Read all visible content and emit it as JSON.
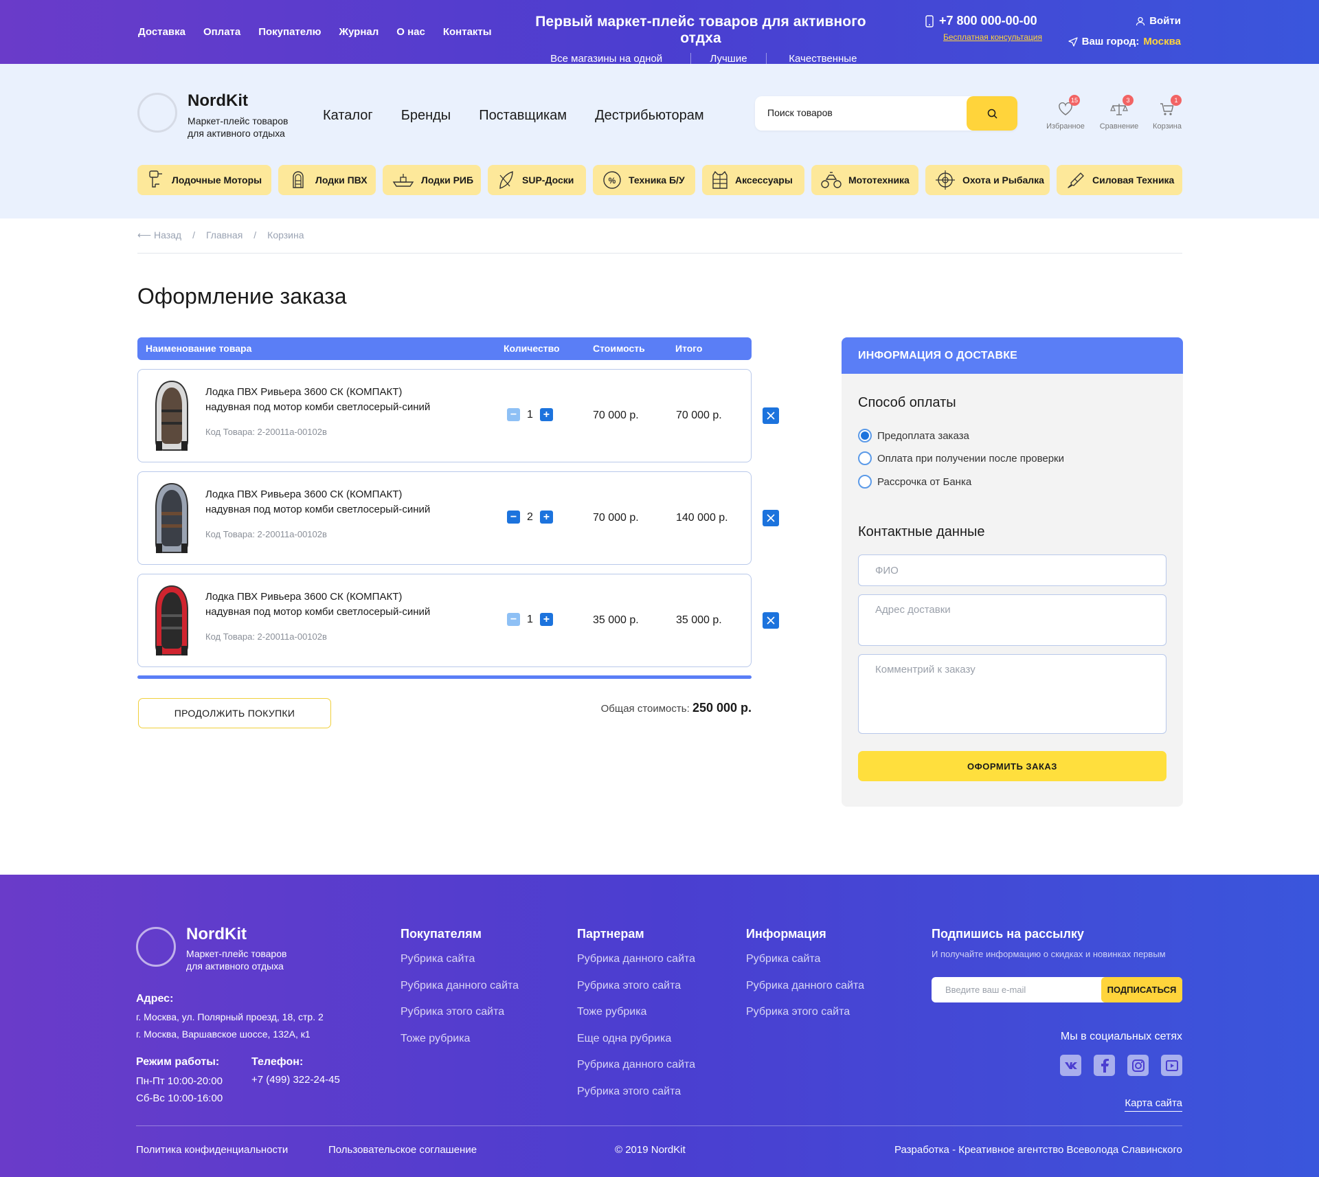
{
  "topbar": {
    "nav": [
      "Доставка",
      "Оплата",
      "Покупателю",
      "Журнал",
      "О нас",
      "Контакты"
    ],
    "slogan_title": "Первый маркет-плейс товаров для активного отдха",
    "slogan_items": [
      "Все магазины на одной платформе",
      "Лучшие цены",
      "Качественные бренды"
    ],
    "phone": "+7 800 000-00-00",
    "consult": "Бесплатная консультация",
    "login": "Войти",
    "city_label": "Ваш город:",
    "city": "Москва",
    "accent": "#ffd43b"
  },
  "header": {
    "brand": "NordKit",
    "brand_sub_1": "Маркет-плейс товаров",
    "brand_sub_2": "для активного отдыха",
    "nav": [
      "Каталог",
      "Бренды",
      "Поставщикам",
      "Дестрибьюторам"
    ],
    "search_placeholder": "Поиск товаров",
    "icons": [
      {
        "label": "Избранное",
        "badge": "15",
        "icon": "heart-icon"
      },
      {
        "label": "Сравнение",
        "badge": "3",
        "icon": "scales-icon"
      },
      {
        "label": "Корзина",
        "badge": "1",
        "icon": "cart-icon"
      }
    ],
    "categories": [
      {
        "label": "Лодочные Моторы",
        "icon": "outboard-motor-icon"
      },
      {
        "label": "Лодки ПВХ",
        "icon": "inflatable-boat-icon"
      },
      {
        "label": "Лодки РИБ",
        "icon": "rib-boat-icon"
      },
      {
        "label": "SUP-Доски",
        "icon": "sup-board-icon"
      },
      {
        "label": "Техника Б/У",
        "icon": "used-equipment-icon"
      },
      {
        "label": "Аксессуары",
        "icon": "life-vest-icon"
      },
      {
        "label": "Мототехника",
        "icon": "atv-icon"
      },
      {
        "label": "Охота и Рыбалка",
        "icon": "crosshair-icon"
      },
      {
        "label": "Силовая Техника",
        "icon": "chainsaw-icon"
      }
    ]
  },
  "breadcrumbs": {
    "back": "Назад",
    "home": "Главная",
    "current": "Корзина"
  },
  "page_title": "Оформление заказа",
  "cart": {
    "columns": {
      "name": "Наименование товара",
      "qty": "Количество",
      "price": "Стоимость",
      "total": "Итого"
    },
    "items": [
      {
        "name_1": "Лодка ПВХ Ривьера 3600 СК (КОМПАКТ)",
        "name_2": "надувная под мотор комби светлосерый-синий",
        "code": "Код Товара: 2-20011а-00102в",
        "qty": "1",
        "price": "70 000 р.",
        "total": "70 000 р.",
        "color": "#d9d9d9"
      },
      {
        "name_1": "Лодка ПВХ Ривьера 3600 СК (КОМПАКТ)",
        "name_2": "надувная под мотор комби светлосерый-синий",
        "code": "Код Товара: 2-20011а-00102в",
        "qty": "2",
        "price": "70 000 р.",
        "total": "140 000 р.",
        "color": "#9aa3b2"
      },
      {
        "name_1": "Лодка ПВХ Ривьера 3600 СК (КОМПАКТ)",
        "name_2": "надувная под мотор комби светлосерый-синий",
        "code": "Код Товара: 2-20011а-00102в",
        "qty": "1",
        "price": "35 000 р.",
        "total": "35 000 р.",
        "color": "#d0242f"
      }
    ],
    "continue": "ПРОДОЛЖИТЬ ПОКУПКИ",
    "sum_label": "Общая стоимость:",
    "sum_value": "250 000 р."
  },
  "delivery": {
    "title": "ИНФОРМАЦИЯ О ДОСТАВКЕ",
    "payment_title": "Способ оплаты",
    "payment_options": [
      "Предоплата заказа",
      "Оплата при получении после проверки",
      "Рассрочка от Банка"
    ],
    "selected_payment": "Предоплата заказа",
    "contacts_title": "Контактные данные",
    "fields": {
      "fio": "ФИО",
      "address": "Адрес доставки",
      "comment": "Комментрий к заказу"
    },
    "submit": "ОФОРМИТЬ ЗАКАЗ"
  },
  "footer": {
    "brand": "NordKit",
    "brand_sub_1": "Маркет-плейс товаров",
    "brand_sub_2": "для активного отдыха",
    "address_title": "Адрес:",
    "address_1": "г. Москва, ул. Полярный проезд, 18, стр. 2",
    "address_2": "г. Москва, Варшавское шоссе, 132А, к1",
    "hours_title": "Режим работы:",
    "hours_1": "Пн-Пт 10:00-20:00",
    "hours_2": "Сб-Вс 10:00-16:00",
    "phone_title": "Телефон:",
    "phone": "+7 (499) 322-24-45",
    "col1": {
      "title": "Покупателям",
      "links": [
        "Рубрика сайта",
        "Рубрика данного сайта",
        "Рубрика этого сайта",
        "Тоже рубрика"
      ]
    },
    "col2": {
      "title": "Партнерам",
      "links": [
        "Рубрика данного сайта",
        "Рубрика этого сайта",
        "Тоже рубрика",
        "Еще одна рубрика",
        "Рубрика данного сайта",
        "Рубрика этого сайта"
      ]
    },
    "col3": {
      "title": "Информация",
      "links": [
        "Рубрика сайта",
        "Рубрика данного сайта",
        "Рубрика этого сайта"
      ]
    },
    "subscribe_title": "Подпишись на рассылку",
    "subscribe_sub": "И получайте информацию о скидках и новинках первым",
    "email_placeholder": "Введите ваш e-mail",
    "subscribe_btn": "ПОДПИСАТЬСЯ",
    "social_title": "Мы в социальных сетях",
    "social": [
      "vk-icon",
      "facebook-icon",
      "instagram-icon",
      "youtube-icon"
    ],
    "sitemap": "Карта сайта",
    "privacy": "Политика конфиденциальности",
    "terms": "Пользовательское соглашение",
    "copyright": "© 2019 NordKit",
    "dev": "Разработка - Креативное агентство Всеволода Славинского"
  }
}
